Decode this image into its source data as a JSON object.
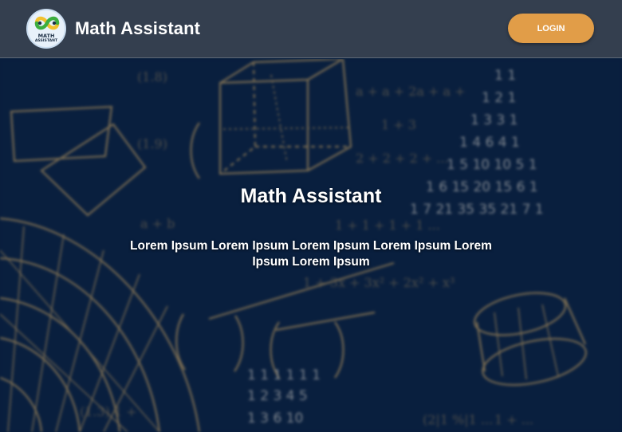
{
  "header": {
    "logo_text_line1": "MATH",
    "logo_text_line2": "ASSISTANT",
    "title": "Math Assistant",
    "login_label": "LOGIN"
  },
  "hero": {
    "title": "Math Assistant",
    "subtitle": "Lorem Ipsum Lorem Ipsum Lorem Ipsum Lorem Ipsum Lorem Ipsum Lorem Ipsum"
  },
  "colors": {
    "header_bg": "#343f4f",
    "accent": "#e19d48",
    "hero_bg": "#0b2240",
    "chalk": "#d9b06a"
  }
}
